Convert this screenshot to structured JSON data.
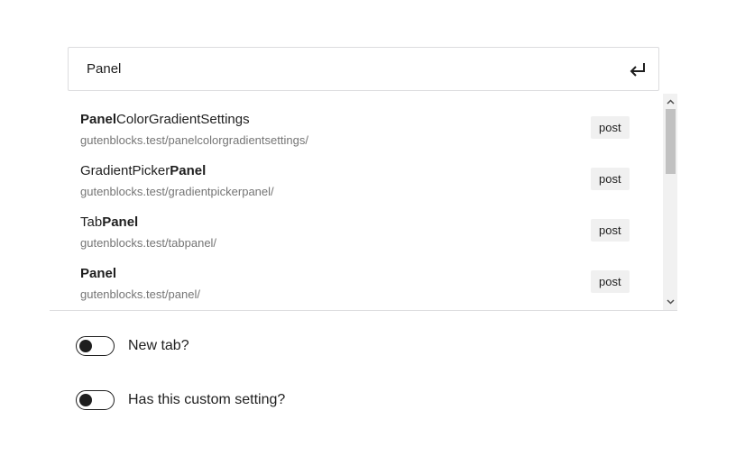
{
  "search": {
    "value": "Panel",
    "submit_icon": "enter-icon"
  },
  "results": [
    {
      "title_bold_prefix": "Panel",
      "title_rest": "ColorGradientSettings",
      "title_plain_prefix": "",
      "title_bold_suffix": "",
      "url": "gutenblocks.test/panelcolorgradientsettings/",
      "type": "post"
    },
    {
      "title_bold_prefix": "",
      "title_rest": "",
      "title_plain_prefix": "GradientPicker",
      "title_bold_suffix": "Panel",
      "url": "gutenblocks.test/gradientpickerpanel/",
      "type": "post"
    },
    {
      "title_bold_prefix": "",
      "title_rest": "",
      "title_plain_prefix": "Tab",
      "title_bold_suffix": "Panel",
      "url": "gutenblocks.test/tabpanel/",
      "type": "post"
    },
    {
      "title_bold_prefix": "Panel",
      "title_rest": "",
      "title_plain_prefix": "",
      "title_bold_suffix": "",
      "url": "gutenblocks.test/panel/",
      "type": "post"
    }
  ],
  "settings": {
    "new_tab_label": "New tab?",
    "new_tab_checked": false,
    "custom_setting_label": "Has this custom setting?",
    "custom_setting_checked": false
  }
}
